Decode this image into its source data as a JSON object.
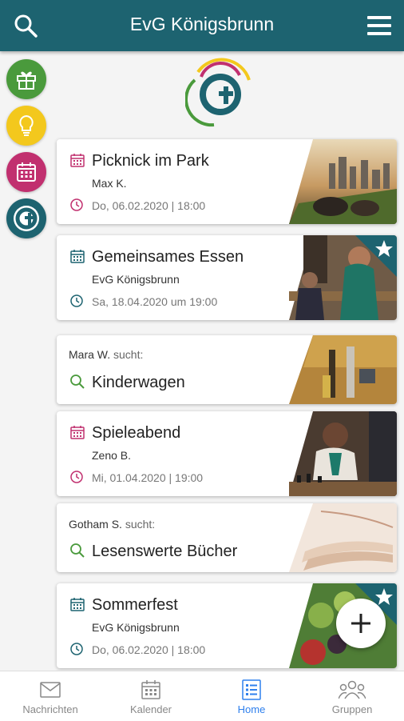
{
  "header": {
    "title": "EvG Königsbrunn",
    "search_icon": "search-icon",
    "menu_icon": "menu-icon"
  },
  "sidebar": {
    "items": [
      {
        "name": "gift",
        "icon": "gift-icon",
        "color": "#4a9a3c"
      },
      {
        "name": "idea",
        "icon": "lightbulb-icon",
        "color": "#f3c81d"
      },
      {
        "name": "calendar",
        "icon": "calendar-icon",
        "color": "#c1306f"
      },
      {
        "name": "church",
        "icon": "church-logo-icon",
        "color": "#1d6370"
      }
    ]
  },
  "feed": [
    {
      "type": "event",
      "title": "Picknick im Park",
      "organizer": "Max K.",
      "datetime": "Do, 06.02.2020 | 18:00",
      "accent": "#c1306f",
      "favorite": false
    },
    {
      "type": "event",
      "title": "Gemeinsames Essen",
      "organizer": "EvG Königsbrunn",
      "datetime": "Sa, 18.04.2020 um 19:00",
      "accent": "#1d6370",
      "favorite": true
    },
    {
      "type": "search",
      "seeker": "Mara W.",
      "seeker_suffix": "sucht:",
      "title": "Kinderwagen",
      "accent": "#4a9a3c"
    },
    {
      "type": "event",
      "title": "Spieleabend",
      "organizer": "Zeno B.",
      "datetime": "Mi, 01.04.2020 | 19:00",
      "accent": "#c1306f",
      "favorite": false
    },
    {
      "type": "search",
      "seeker": "Gotham S.",
      "seeker_suffix": "sucht:",
      "title": "Lesenswerte Bücher",
      "accent": "#4a9a3c"
    },
    {
      "type": "event",
      "title": "Sommerfest",
      "organizer": "EvG Königsbrunn",
      "datetime": "Do, 06.02.2020 | 18:00",
      "accent": "#1d6370",
      "favorite": true
    }
  ],
  "fab": {
    "icon": "plus-icon"
  },
  "bottom_nav": [
    {
      "label": "Nachrichten",
      "icon": "mail-icon",
      "active": false
    },
    {
      "label": "Kalender",
      "icon": "calendar-icon",
      "active": false
    },
    {
      "label": "Home",
      "icon": "list-icon",
      "active": true
    },
    {
      "label": "Gruppen",
      "icon": "group-icon",
      "active": false
    }
  ],
  "colors": {
    "primary": "#1d6370",
    "event_pink": "#c1306f",
    "search_green": "#4a9a3c",
    "active_nav": "#2f80ed"
  }
}
